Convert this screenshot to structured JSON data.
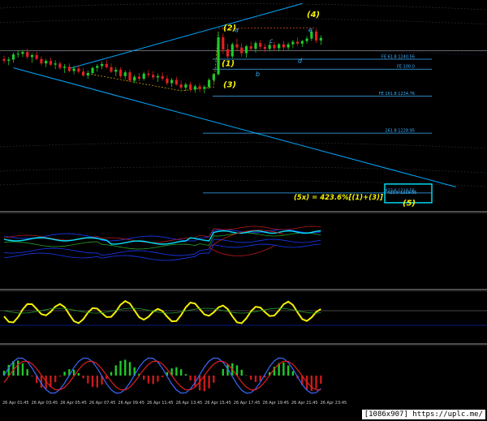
{
  "chart_data": [
    {
      "type": "candlestick",
      "title": "",
      "wave_labels": [
        {
          "text": "(1)",
          "x": "26 Apr 15:45",
          "price": 1240.6
        },
        {
          "text": "(2)",
          "x": "26 Apr 15:45",
          "price": 1244.9
        },
        {
          "text": "(3)",
          "x": "26 Apr 15:45",
          "price": 1237.7
        },
        {
          "text": "(4)",
          "x": "26 Apr 21:45",
          "price": 1247.2
        },
        {
          "text": "(5)",
          "x": "26 Apr 21:45",
          "price": 1217.6
        }
      ],
      "sub_wave_labels": [
        {
          "text": "a",
          "x": "26 Apr 17:45",
          "price": 1244.8
        },
        {
          "text": "b",
          "x": "26 Apr 17:45",
          "price": 1237.9
        },
        {
          "text": "c",
          "x": "26 Apr 19:45",
          "price": 1243.1
        },
        {
          "text": "d",
          "x": "26 Apr 21:45",
          "price": 1240.0
        },
        {
          "text": "e",
          "x": "26 Apr 21:45",
          "price": 1244.8
        }
      ],
      "fib_levels": [
        {
          "label": "FE 61.8 1240.56",
          "price": 1240.56
        },
        {
          "label": "FE 100.0",
          "price": 1239.0
        },
        {
          "label": "FE 161.8 1234.76",
          "price": 1234.76
        },
        {
          "label": "261.8 1228.95",
          "price": 1228.95
        },
        {
          "label": "423.6 1219.56",
          "price": 1219.56
        }
      ],
      "formula": "(5x) = 423.6%[(1)+(3)]",
      "target_box_label": "423.6 1219.56",
      "ohlc": [
        [
          1240.6,
          1241.1,
          1239.9,
          1240.3
        ],
        [
          1240.3,
          1240.9,
          1239.6,
          1240.5
        ],
        [
          1240.5,
          1241.6,
          1240.0,
          1241.3
        ],
        [
          1241.3,
          1241.9,
          1240.8,
          1241.4
        ],
        [
          1241.4,
          1242.0,
          1240.9,
          1241.7
        ],
        [
          1241.7,
          1242.2,
          1240.6,
          1240.9
        ],
        [
          1240.9,
          1241.5,
          1240.0,
          1241.2
        ],
        [
          1241.2,
          1241.7,
          1240.4,
          1240.6
        ],
        [
          1240.6,
          1241.0,
          1239.6,
          1239.9
        ],
        [
          1239.9,
          1240.6,
          1239.3,
          1240.3
        ],
        [
          1240.3,
          1240.8,
          1239.5,
          1239.7
        ],
        [
          1239.7,
          1240.4,
          1239.0,
          1239.9
        ],
        [
          1239.9,
          1240.2,
          1238.9,
          1239.2
        ],
        [
          1239.2,
          1239.8,
          1238.4,
          1239.4
        ],
        [
          1239.4,
          1239.9,
          1238.5,
          1238.7
        ],
        [
          1238.7,
          1239.5,
          1238.2,
          1239.1
        ],
        [
          1239.1,
          1239.6,
          1238.3,
          1238.6
        ],
        [
          1238.6,
          1239.2,
          1237.8,
          1238.0
        ],
        [
          1238.0,
          1238.8,
          1237.5,
          1238.4
        ],
        [
          1238.4,
          1239.4,
          1238.1,
          1239.2
        ],
        [
          1239.2,
          1239.8,
          1238.6,
          1239.5
        ],
        [
          1239.5,
          1240.2,
          1239.0,
          1239.8
        ],
        [
          1239.8,
          1240.4,
          1239.1,
          1239.3
        ],
        [
          1239.3,
          1239.9,
          1238.4,
          1238.6
        ],
        [
          1238.6,
          1239.3,
          1237.9,
          1238.9
        ],
        [
          1238.9,
          1239.3,
          1237.6,
          1237.9
        ],
        [
          1237.9,
          1238.8,
          1237.4,
          1238.5
        ],
        [
          1238.5,
          1238.9,
          1237.0,
          1237.2
        ],
        [
          1237.2,
          1238.1,
          1236.8,
          1237.8
        ],
        [
          1237.8,
          1238.4,
          1237.1,
          1237.5
        ],
        [
          1237.5,
          1238.6,
          1237.2,
          1238.3
        ],
        [
          1238.3,
          1238.9,
          1237.7,
          1238.1
        ],
        [
          1238.1,
          1238.7,
          1237.4,
          1237.7
        ],
        [
          1237.7,
          1238.3,
          1237.0,
          1237.9
        ],
        [
          1237.9,
          1238.5,
          1237.2,
          1237.5
        ],
        [
          1237.5,
          1238.0,
          1236.5,
          1236.8
        ],
        [
          1236.8,
          1237.6,
          1236.2,
          1237.3
        ],
        [
          1237.3,
          1237.8,
          1236.4,
          1236.6
        ],
        [
          1236.6,
          1237.2,
          1235.8,
          1236.1
        ],
        [
          1236.1,
          1236.9,
          1235.6,
          1236.6
        ],
        [
          1236.6,
          1237.0,
          1235.5,
          1235.8
        ],
        [
          1235.8,
          1236.6,
          1235.3,
          1236.3
        ],
        [
          1236.3,
          1236.8,
          1235.4,
          1235.9
        ],
        [
          1235.9,
          1236.5,
          1235.2,
          1236.2
        ],
        [
          1236.2,
          1237.6,
          1235.9,
          1237.3
        ],
        [
          1237.3,
          1238.4,
          1236.9,
          1238.2
        ],
        [
          1238.2,
          1244.9,
          1238.0,
          1244.0
        ],
        [
          1244.0,
          1244.6,
          1241.4,
          1242.1
        ],
        [
          1242.1,
          1243.0,
          1240.6,
          1241.0
        ],
        [
          1241.0,
          1243.2,
          1240.7,
          1242.9
        ],
        [
          1242.9,
          1243.8,
          1241.9,
          1242.4
        ],
        [
          1242.4,
          1243.1,
          1240.9,
          1241.5
        ],
        [
          1241.5,
          1242.8,
          1240.8,
          1242.6
        ],
        [
          1242.6,
          1243.3,
          1241.8,
          1242.2
        ],
        [
          1242.2,
          1243.4,
          1241.6,
          1243.1
        ],
        [
          1243.1,
          1243.6,
          1242.1,
          1242.5
        ],
        [
          1242.5,
          1243.0,
          1241.7,
          1242.2
        ],
        [
          1242.2,
          1243.2,
          1241.8,
          1242.8
        ],
        [
          1242.8,
          1243.3,
          1241.9,
          1242.3
        ],
        [
          1242.3,
          1243.1,
          1241.8,
          1242.9
        ],
        [
          1242.9,
          1243.4,
          1242.0,
          1242.4
        ],
        [
          1242.4,
          1243.2,
          1242.0,
          1242.9
        ],
        [
          1242.9,
          1243.6,
          1242.3,
          1243.3
        ],
        [
          1243.3,
          1244.0,
          1242.7,
          1243.0
        ],
        [
          1243.0,
          1243.6,
          1242.5,
          1243.4
        ],
        [
          1243.4,
          1244.2,
          1243.0,
          1243.8
        ],
        [
          1243.8,
          1245.2,
          1243.4,
          1244.9
        ],
        [
          1244.9,
          1245.3,
          1243.1,
          1243.5
        ],
        [
          1243.5,
          1244.3,
          1242.8,
          1243.9
        ]
      ],
      "indicator_panes": [
        {
          "id": "pane2",
          "type": "line",
          "series_count": 5
        },
        {
          "id": "pane3",
          "type": "oscillator",
          "series_count": 3
        },
        {
          "id": "pane4",
          "type": "histogram+lines",
          "series_count": 3
        }
      ],
      "x_tick_labels": [
        "26 Apr 01:45",
        "26 Apr 03:45",
        "26 Apr 05:45",
        "26 Apr 07:45",
        "26 Apr 09:45",
        "26 Apr 11:45",
        "26 Apr 13:45",
        "26 Apr 15:45",
        "26 Apr 17:45",
        "26 Apr 19:45",
        "26 Apr 21:45",
        "26 Apr 23:45"
      ],
      "colors": {
        "bull": "#1fc92a",
        "bear": "#e02020",
        "fib": "#3ab0ff",
        "label": "#f5f000",
        "box": "#00e5ff",
        "channel": "#00a8ff"
      }
    }
  ],
  "watermark": "[1086x907] https://uplc.me/"
}
